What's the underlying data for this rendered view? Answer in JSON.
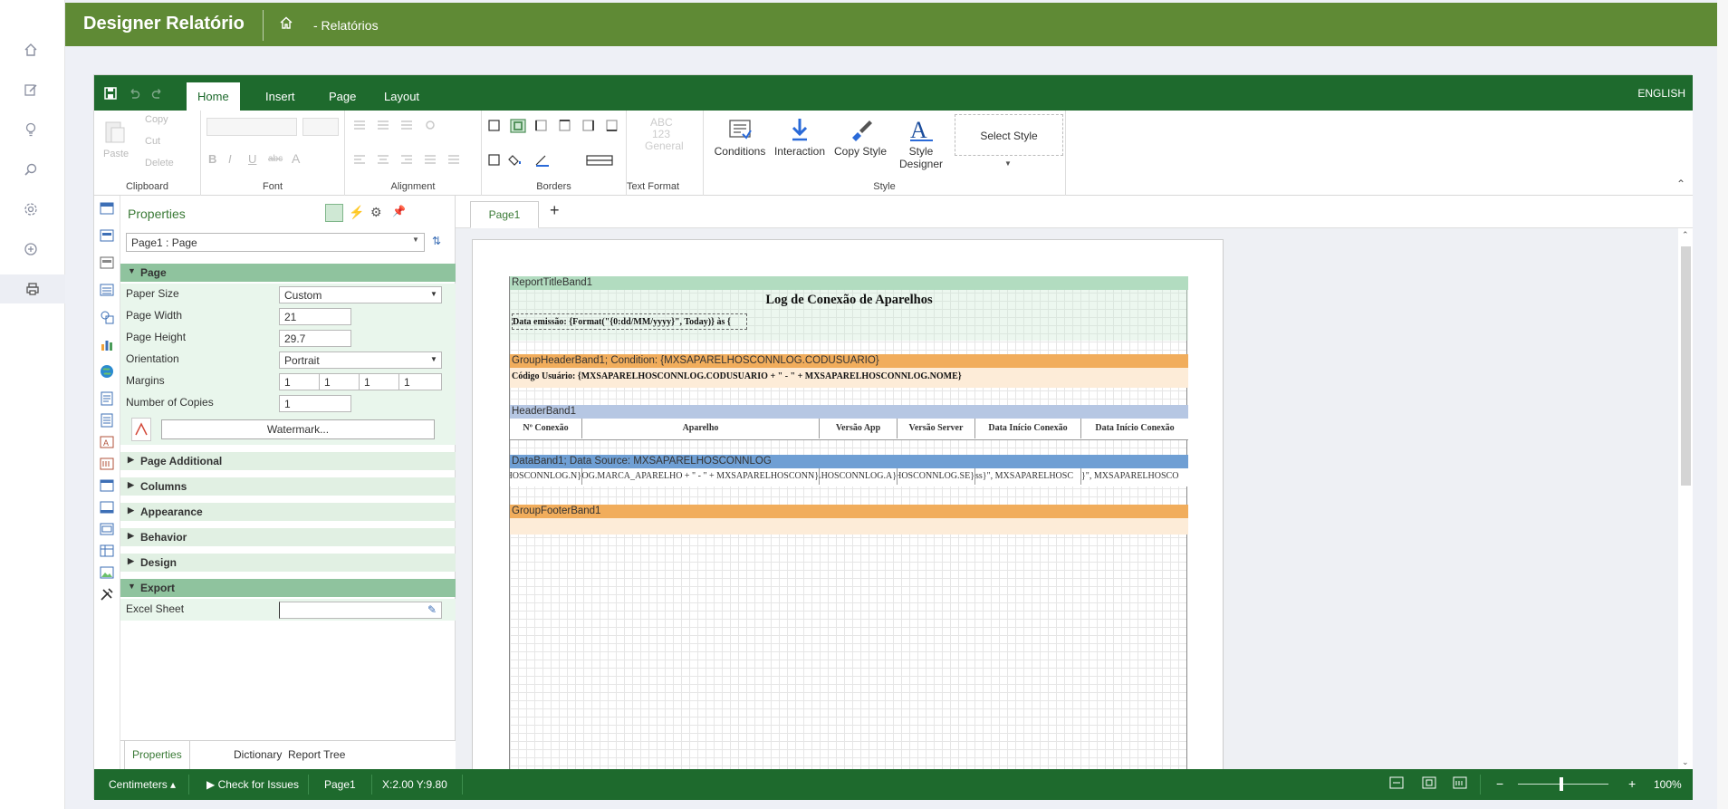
{
  "app": {
    "title": "Designer Relatório",
    "breadcrumb": "- Relatórios"
  },
  "ribbon": {
    "tabs": [
      "Home",
      "Insert",
      "Page",
      "Layout"
    ],
    "active_tab": "Home",
    "language": "ENGLISH",
    "clipboard": {
      "label": "Clipboard",
      "paste": "Paste",
      "copy": "Copy",
      "cut": "Cut",
      "delete": "Delete"
    },
    "font": {
      "label": "Font"
    },
    "alignment": {
      "label": "Alignment"
    },
    "borders": {
      "label": "Borders"
    },
    "text_format": {
      "label": "Text Format",
      "icon_text": "ABC",
      "icon_num": "123",
      "value": "General"
    },
    "style": {
      "label": "Style",
      "conditions": "Conditions",
      "interaction": "Interaction",
      "copy_style": "Copy Style",
      "style_designer": "Style Designer",
      "select_style": "Select Style"
    }
  },
  "properties": {
    "title": "Properties",
    "selected": "Page1 : Page",
    "cat_page": "Page",
    "rows": {
      "paper_size": {
        "label": "Paper Size",
        "value": "Custom"
      },
      "page_width": {
        "label": "Page Width",
        "value": "21"
      },
      "page_height": {
        "label": "Page Height",
        "value": "29.7"
      },
      "orientation": {
        "label": "Orientation",
        "value": "Portrait"
      },
      "margins": {
        "label": "Margins",
        "values": [
          "1",
          "1",
          "1",
          "1"
        ]
      },
      "copies": {
        "label": "Number of Copies",
        "value": "1"
      }
    },
    "watermark": "Watermark...",
    "categories": [
      "Page Additional",
      "Columns",
      "Appearance",
      "Behavior",
      "Design"
    ],
    "cat_export": "Export",
    "excel_sheet": {
      "label": "Excel Sheet",
      "value": ""
    },
    "bottom_tabs": [
      "Properties",
      "Dictionary",
      "Report Tree"
    ]
  },
  "canvas": {
    "page_tab": "Page1",
    "bands": {
      "title": "ReportTitleBand1",
      "group_header": "GroupHeaderBand1; Condition: {MXSAPARELHOSCONNLOG.CODUSUARIO}",
      "header": "HeaderBand1",
      "data": "DataBand1; Data Source: MXSAPARELHOSCONNLOG",
      "group_footer": "GroupFooterBand1"
    },
    "report_title": "Log de Conexão de Aparelhos",
    "emission": "Data emissão: {Format(\"{0:dd/MM/yyyy}\", Today)} às {",
    "group_text": "Código Usuário: {MXSAPARELHOSCONNLOG.CODUSUARIO + \" - \" + MXSAPARELHOSCONNLOG.NOME}",
    "headers": [
      "Nº Conexão",
      "Aparelho",
      "Versão App",
      "Versão Server",
      "Data Início Conexão",
      "Data Início Conexão"
    ],
    "data_cells": [
      "{MXSAPARELHOSCONNLOG.N",
      "{MXSAPARELHOSCONNLOG.MARCA_APARELHO + \" - \" + MXSAPARELHOSCONN",
      "{MXSAPARELHOSCONNLOG.A",
      "{MXSAPARELHOSCONNLOG.SE",
      "ss}\", MXSAPARELHOSC",
      "}\", MXSAPARELHOSCO"
    ]
  },
  "status": {
    "units": "Centimeters",
    "check": "Check for Issues",
    "page": "Page1",
    "coords": "X:2.00 Y:9.80",
    "zoom": "100%"
  }
}
